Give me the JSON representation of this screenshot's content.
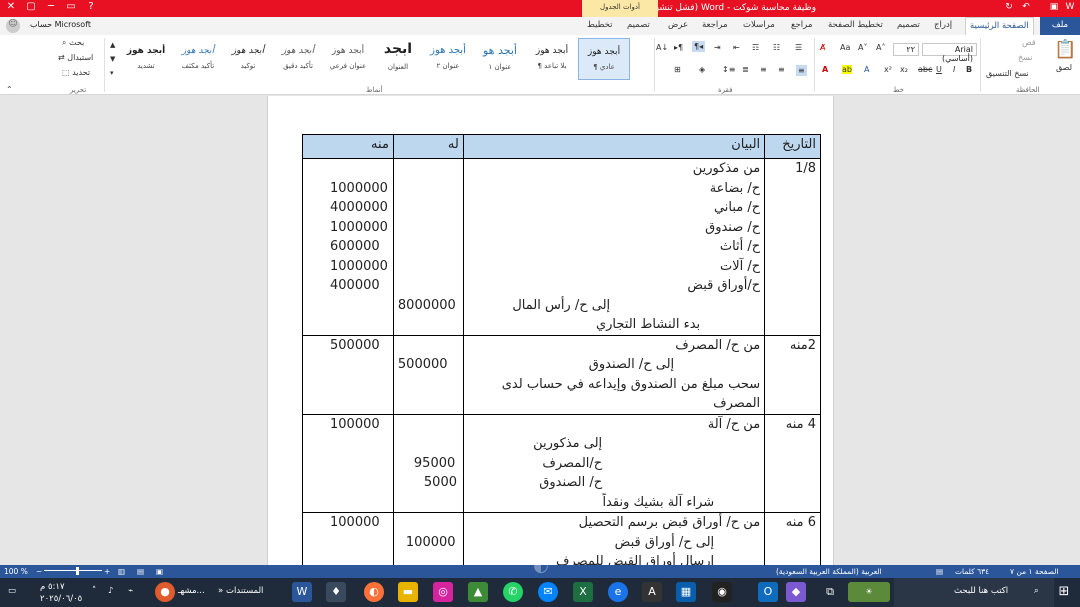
{
  "window": {
    "title": "وظيفة محاسبة شوكت - Word (فشل تنشيط المنتج)",
    "context_group": "أدوات الجدول"
  },
  "tabs": {
    "file": "ملف",
    "home": "الصفحة الرئيسية",
    "insert": "إدراج",
    "design": "تصميم",
    "layout": "تخطيط الصفحة",
    "references": "مراجع",
    "mailings": "مراسلات",
    "review": "مراجعة",
    "view": "عرض",
    "table_design": "تصميم",
    "table_layout": "تخطيط",
    "account": "حساب Microsoft"
  },
  "ribbon": {
    "clipboard": {
      "label": "الحافظة",
      "paste": "لصق",
      "cut": "قص",
      "copy": "نسخ",
      "format_painter": "نسخ التنسيق"
    },
    "font": {
      "label": "خط",
      "font_name": "Arial (أساسي)",
      "font_size": "٢٢"
    },
    "paragraph": {
      "label": "فقرة"
    },
    "styles": {
      "label": "أنماط",
      "items": [
        {
          "sample": "أبجد هوز",
          "name": "¶ عادي"
        },
        {
          "sample": "أبجد هوز",
          "name": "¶ بلا تباعد"
        },
        {
          "sample": "أبجد هو",
          "name": "عنوان ١"
        },
        {
          "sample": "أبجد هوز",
          "name": "عنوان ٢"
        },
        {
          "sample": "ابجد",
          "name": "العنوان"
        },
        {
          "sample": "أبجد هوز",
          "name": "عنوان فرعي"
        },
        {
          "sample": "أبجد هوز",
          "name": "تأكيد دقيق"
        },
        {
          "sample": "أبجد هوز",
          "name": "توكيد"
        },
        {
          "sample": "أبجد هوز",
          "name": "تأكيد مكثف"
        },
        {
          "sample": "أبجد هوز",
          "name": "تشديد"
        }
      ]
    },
    "editing": {
      "label": "تحرير",
      "find": "بحث",
      "replace": "استبدال",
      "select": "تحديد"
    }
  },
  "ledger": {
    "headers": {
      "debit": "منه",
      "credit": "له",
      "description": "البيان",
      "date": "التاريخ"
    },
    "entries": [
      {
        "debit": [
          "",
          "1000000",
          "4000000",
          "1000000",
          "600000",
          "1000000",
          "400000",
          "",
          ""
        ],
        "credit": [
          "",
          "",
          "",
          "",
          "",
          "",
          "",
          "8000000",
          ""
        ],
        "description": [
          "من مذكورين",
          "ح/ بضاعة",
          "ح/ مباني",
          "ح/ صندوق",
          "ح/ أثاث",
          "ح/ آلات",
          "ح/أوراق قبض",
          "إلى ح/ رأس المال",
          "بدء النشاط التجاري"
        ],
        "date": "1/8"
      },
      {
        "debit": [
          "500000",
          "",
          "",
          ""
        ],
        "credit": [
          "",
          "500000",
          "",
          ""
        ],
        "description": [
          "من ح/ المصرف",
          "إلى ح/ الصندوق",
          "سحب مبلغ من الصندوق وإيداعه في حساب لدى",
          "المصرف"
        ],
        "date": "2منه"
      },
      {
        "debit": [
          "100000",
          "",
          "",
          "",
          ""
        ],
        "credit": [
          "",
          "",
          "95000",
          "5000",
          ""
        ],
        "description": [
          "من ح/ آلة",
          "إلى مذكورين",
          "ح/المصرف",
          "ح/ الصندوق",
          "شراء آلة بشيك ونقداً"
        ],
        "date": "4 منه"
      },
      {
        "debit": [
          "100000",
          "",
          ""
        ],
        "credit": [
          "",
          "100000",
          ""
        ],
        "description": [
          "من ح/ أوراق قبض برسم التحصيل",
          "إلى ح/ أوراق قبض",
          "ارسال أوراق القبض للمصرف"
        ],
        "date": "6 منه"
      }
    ]
  },
  "statusbar": {
    "page": "الصفحة ١ من ٧",
    "words": "٦٣٤ كلمات",
    "language": "العربية (المملكة العربية السعودية)",
    "zoom": "100 %"
  },
  "taskbar": {
    "search_placeholder": "اكتب هنا للبحث",
    "documents": "المستندات",
    "shared": "مشهـ...",
    "time": "٥:١٧ م",
    "date": "٢٠٢٥/٠٦/٠٥"
  },
  "colors": {
    "titlebar": "#e81123",
    "word_blue": "#2b579a",
    "table_header": "#bdd7ee",
    "taskbar": "#1f2b3a"
  }
}
